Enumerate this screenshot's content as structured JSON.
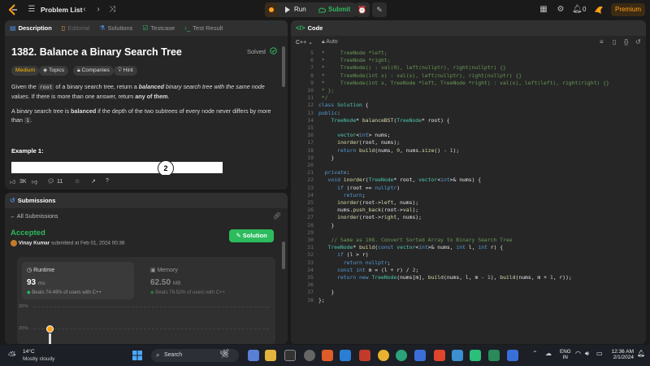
{
  "topbar": {
    "problem_list": "Problem List",
    "run": "Run",
    "submit": "Submit",
    "streak_count": "0",
    "premium": "Premium"
  },
  "left_tabs": [
    "Description",
    "Editorial",
    "Solutions",
    "Testcase",
    "Test Result"
  ],
  "problem": {
    "title": "1382. Balance a Binary Search Tree",
    "status": "Solved",
    "difficulty": "Medium",
    "tags": [
      "Topics",
      "Companies",
      "Hint"
    ],
    "desc1_a": "Given the ",
    "desc1_code": "root",
    "desc1_b": " of a binary search tree, return a ",
    "desc1_c": "balanced",
    "desc1_d": " binary search tree with the same node values",
    "desc1_e": ". If there is more than one answer, return ",
    "desc1_f": "any of them",
    "desc1_g": ".",
    "desc2_a": "A binary search tree is ",
    "desc2_b": "balanced",
    "desc2_c": " if the depth of the two subtrees of every node never differs by more than ",
    "desc2_code": "1",
    "desc2_d": ".",
    "example_label": "Example 1:",
    "tree_node": "2",
    "likes": "3K",
    "comments": "11"
  },
  "submissions": {
    "header": "Submissions",
    "all": "All Submissions",
    "verdict": "Accepted",
    "author": "Vinay Kumar",
    "submitted_text": "submitted at Feb 01, 2024 00:36",
    "solution_btn": "Solution",
    "runtime_label": "Runtime",
    "runtime_value": "93",
    "runtime_unit": "ms",
    "runtime_beats": "Beats 74.49% of users with C++",
    "memory_label": "Memory",
    "memory_value": "62.50",
    "memory_unit": "MB",
    "memory_beats": "Beats 78.52% of users with C++",
    "axis_30": "30%",
    "axis_20": "20%"
  },
  "code": {
    "header": "Code",
    "language": "C++",
    "mode": "Auto",
    "lines": [
      {
        "n": "5",
        "t": " *     TreeNode *left;"
      },
      {
        "n": "6",
        "t": " *     TreeNode *right;"
      },
      {
        "n": "7",
        "t": " *     TreeNode() : val(0), left(nullptr), right(nullptr) {}"
      },
      {
        "n": "8",
        "t": " *     TreeNode(int x) : val(x), left(nullptr), right(nullptr) {}"
      },
      {
        "n": "9",
        "t": " *     TreeNode(int x, TreeNode *left, TreeNode *right) : val(x), left(left), right(right) {}"
      },
      {
        "n": "10",
        "t": " * };"
      },
      {
        "n": "11",
        "t": " */"
      },
      {
        "n": "12",
        "t": "class Solution {"
      },
      {
        "n": "13",
        "t": "public:"
      },
      {
        "n": "14",
        "t": "    TreeNode* balanceBST(TreeNode* root) {"
      },
      {
        "n": "15",
        "t": ""
      },
      {
        "n": "16",
        "t": "      vector<int> nums;"
      },
      {
        "n": "17",
        "t": "      inorder(root, nums);"
      },
      {
        "n": "18",
        "t": "      return build(nums, 0, nums.size() - 1);"
      },
      {
        "n": "19",
        "t": "    }"
      },
      {
        "n": "20",
        "t": ""
      },
      {
        "n": "21",
        "t": "  private:"
      },
      {
        "n": "22",
        "t": "   void inorder(TreeNode* root, vector<int>& nums) {"
      },
      {
        "n": "23",
        "t": "      if (root == nullptr)"
      },
      {
        "n": "24",
        "t": "        return;"
      },
      {
        "n": "25",
        "t": "      inorder(root->left, nums);"
      },
      {
        "n": "26",
        "t": "      nums.push_back(root->val);"
      },
      {
        "n": "27",
        "t": "      inorder(root->right, nums);"
      },
      {
        "n": "28",
        "t": "    }"
      },
      {
        "n": "29",
        "t": ""
      },
      {
        "n": "30",
        "t": "    // Same as 108. Convert Sorted Array to Binary Search Tree"
      },
      {
        "n": "31",
        "t": "   TreeNode* build(const vector<int>& nums, int l, int r) {"
      },
      {
        "n": "32",
        "t": "      if (l > r)"
      },
      {
        "n": "33",
        "t": "        return nullptr;"
      },
      {
        "n": "34",
        "t": "      const int m = (l + r) / 2;"
      },
      {
        "n": "35",
        "t": "      return new TreeNode(nums[m], build(nums, l, m - 1), build(nums, m + 1, r));"
      },
      {
        "n": "36",
        "t": ""
      },
      {
        "n": "37",
        "t": "    }"
      },
      {
        "n": "38",
        "t": "};"
      }
    ]
  },
  "taskbar": {
    "temp": "14°C",
    "weather": "Mostly cloudy",
    "search": "Search",
    "lang1": "ENG",
    "lang2": "IN",
    "time": "12:36 AM",
    "date": "2/1/2024"
  },
  "colors": {
    "accent_orange": "#ffa116",
    "green": "#2cbb5d",
    "panel": "#262626",
    "bg": "#1a1a1a"
  }
}
